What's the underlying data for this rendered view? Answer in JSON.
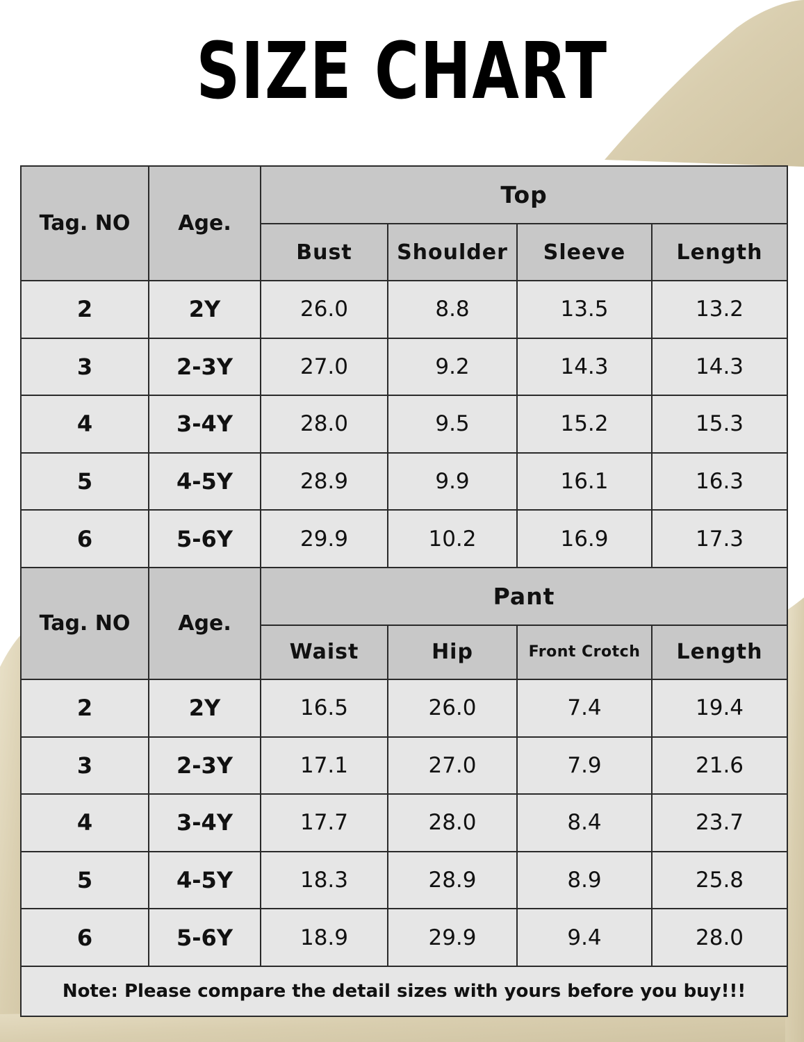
{
  "title": "SIZE CHART",
  "headers": {
    "tag": "Tag. NO",
    "age": "Age."
  },
  "top": {
    "group_label": "Top",
    "columns": [
      "Bust",
      "Shoulder",
      "Sleeve",
      "Length"
    ],
    "rows": [
      {
        "tag": "2",
        "age": "2Y",
        "values": [
          "26.0",
          "8.8",
          "13.5",
          "13.2"
        ]
      },
      {
        "tag": "3",
        "age": "2-3Y",
        "values": [
          "27.0",
          "9.2",
          "14.3",
          "14.3"
        ]
      },
      {
        "tag": "4",
        "age": "3-4Y",
        "values": [
          "28.0",
          "9.5",
          "15.2",
          "15.3"
        ]
      },
      {
        "tag": "5",
        "age": "4-5Y",
        "values": [
          "28.9",
          "9.9",
          "16.1",
          "16.3"
        ]
      },
      {
        "tag": "6",
        "age": "5-6Y",
        "values": [
          "29.9",
          "10.2",
          "16.9",
          "17.3"
        ]
      }
    ]
  },
  "pant": {
    "group_label": "Pant",
    "columns": [
      "Waist",
      "Hip",
      "Front Crotch",
      "Length"
    ],
    "rows": [
      {
        "tag": "2",
        "age": "2Y",
        "values": [
          "16.5",
          "26.0",
          "7.4",
          "19.4"
        ]
      },
      {
        "tag": "3",
        "age": "2-3Y",
        "values": [
          "17.1",
          "27.0",
          "7.9",
          "21.6"
        ]
      },
      {
        "tag": "4",
        "age": "3-4Y",
        "values": [
          "17.7",
          "28.0",
          "8.4",
          "23.7"
        ]
      },
      {
        "tag": "5",
        "age": "4-5Y",
        "values": [
          "18.3",
          "28.9",
          "8.9",
          "25.8"
        ]
      },
      {
        "tag": "6",
        "age": "5-6Y",
        "values": [
          "18.9",
          "29.9",
          "9.4",
          "28.0"
        ]
      }
    ]
  },
  "note": "Note: Please compare the detail sizes with yours before you buy!!!",
  "colors": {
    "header_bg": "#c8c8c8",
    "cell_bg": "#e6e6e6",
    "border": "#2a2a2a",
    "fabric": "#ddd2b4"
  }
}
